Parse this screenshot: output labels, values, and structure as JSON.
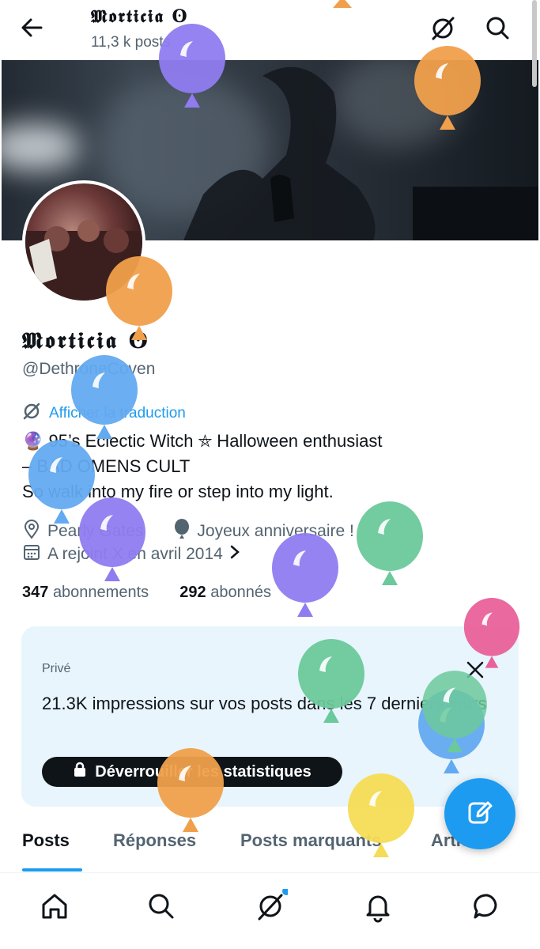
{
  "header": {
    "display_name": "𝕸𝖔𝖗𝖙𝖎𝖈𝖎𝖆 ʘ",
    "post_count": "11,3 k posts",
    "back_icon": "arrow-left-icon",
    "grok_icon": "grok-icon",
    "search_icon": "search-icon"
  },
  "profile": {
    "display_name": "𝕸𝖔𝖗𝖙𝖎𝖈𝖎𝖆 ʘ",
    "handle": "@DethroneCoven",
    "translate_label": "Afficher la traduction",
    "bio_line1": "🔮 95’s Eclectic Witch ⛤ Halloween enthusiast",
    "bio_line2": "– BAD OMENS CULT",
    "bio_line3": "So walk into my fire or step into my light.",
    "location": "Pearly Gates",
    "birthday": "Joyeux anniversaire !",
    "joined": "A rejoint X en avril 2014",
    "following_count": "347",
    "following_label": "abonnements",
    "followers_count": "292",
    "followers_label": "abonnés"
  },
  "card": {
    "label": "Privé",
    "title": "21.3K impressions sur vos posts dans les 7 derniers jours",
    "button_label": "Déverrouiller les statistiques"
  },
  "tabs": [
    {
      "label": "Posts",
      "active": true
    },
    {
      "label": "Réponses",
      "active": false
    },
    {
      "label": "Posts marquants",
      "active": false
    },
    {
      "label": "Articles",
      "active": false
    }
  ],
  "bottom_nav": [
    "home-icon",
    "search-icon",
    "grok-icon",
    "notifications-icon",
    "messages-icon"
  ],
  "colors": {
    "accent": "#1d9bf0",
    "text": "#0f1419",
    "secondary": "#536471",
    "card_bg": "#e8f5fd",
    "balloon_purple": "#8f7cf0",
    "balloon_orange": "#f0a04b",
    "balloon_blue": "#63aaf0",
    "balloon_green": "#6cc99b",
    "balloon_pink": "#e9619a",
    "balloon_yellow": "#f5dc55"
  }
}
